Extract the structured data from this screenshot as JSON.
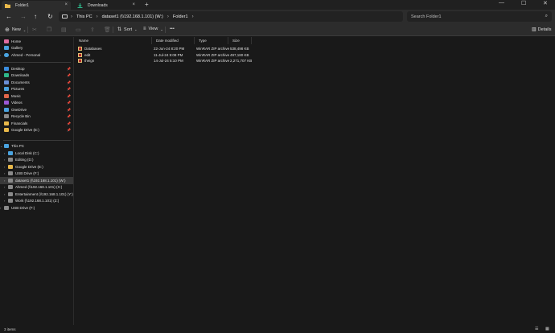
{
  "tabs": [
    {
      "label": "Folder1",
      "active": true
    },
    {
      "label": "Downloads",
      "active": false
    }
  ],
  "window_controls": {
    "minimize": "—",
    "maximize": "☐",
    "close": "✕"
  },
  "address": {
    "crumbs": [
      "This PC",
      "dataset1 (\\\\192.168.1.101) (W:)",
      "Folder1"
    ],
    "separator": "›"
  },
  "search": {
    "placeholder": "Search Folder1"
  },
  "toolbar": {
    "new_label": "New",
    "sort_label": "Sort",
    "view_label": "View",
    "more_label": "•••",
    "details_label": "Details"
  },
  "sidebar": {
    "quick": [
      {
        "label": "Home",
        "icon": "home-icon",
        "color": "#e06c9f"
      },
      {
        "label": "Gallery",
        "icon": "gallery-icon",
        "color": "#4aa3df"
      },
      {
        "label": "Ahmed - Personal",
        "icon": "cloud-icon",
        "color": "#4aa3df"
      }
    ],
    "pinned": [
      {
        "label": "Desktop",
        "icon": "desktop-icon",
        "color": "#3b8ee0"
      },
      {
        "label": "Downloads",
        "icon": "downloads-icon",
        "color": "#2eb88a"
      },
      {
        "label": "Documents",
        "icon": "documents-icon",
        "color": "#6a8fd6"
      },
      {
        "label": "Pictures",
        "icon": "pictures-icon",
        "color": "#4aa3df"
      },
      {
        "label": "Music",
        "icon": "music-icon",
        "color": "#e0664a"
      },
      {
        "label": "Videos",
        "icon": "videos-icon",
        "color": "#9b59d6"
      },
      {
        "label": "OneDrive",
        "icon": "onedrive-icon",
        "color": "#4aa3df"
      },
      {
        "label": "Recycle Bin",
        "icon": "recycle-bin-icon",
        "color": "#8a8a8a"
      },
      {
        "label": "Financials",
        "icon": "folder-icon",
        "color": "#e8b84a"
      },
      {
        "label": "Google Drive (E:)",
        "icon": "drive-icon",
        "color": "#e8b84a"
      }
    ],
    "pc_label": "This PC",
    "drives": [
      {
        "label": "Local Disk (C:)",
        "icon": "disk-icon",
        "color": "#4aa3df",
        "selected": false
      },
      {
        "label": "Editing (D:)",
        "icon": "disk-icon",
        "color": "#8a8a8a",
        "selected": false
      },
      {
        "label": "Google Drive (E:)",
        "icon": "drive-icon",
        "color": "#e8b84a",
        "selected": false
      },
      {
        "label": "USB Drive (F:)",
        "icon": "usb-icon",
        "color": "#8a8a8a",
        "selected": false
      },
      {
        "label": "dataset1 (\\\\192.168.1.101) (W:)",
        "icon": "network-drive-icon",
        "color": "#8a8a8a",
        "selected": true
      },
      {
        "label": "Ahmed (\\\\192.168.1.101) (X:)",
        "icon": "network-drive-icon",
        "color": "#8a8a8a",
        "selected": false
      },
      {
        "label": "Entertainment (\\\\192.168.1.101) (Y:)",
        "icon": "network-drive-icon",
        "color": "#8a8a8a",
        "selected": false
      },
      {
        "label": "Work (\\\\192.168.1.101) (Z:)",
        "icon": "network-drive-icon",
        "color": "#8a8a8a",
        "selected": false
      }
    ],
    "usb_label": "USB Drive (F:)"
  },
  "columns": [
    "Name",
    "Date modified",
    "Type",
    "Size"
  ],
  "files": [
    {
      "name": "Databases",
      "date": "22-Jun-24 8:20 PM",
      "type": "WinRAR ZIP archive",
      "size": "538,498 KB"
    },
    {
      "name": "edit",
      "date": "11-Jul-24 9:08 PM",
      "type": "WinRAR ZIP archive",
      "size": "497,180 KB"
    },
    {
      "name": "theign",
      "date": "14-Jul-24 5:10 PM",
      "type": "WinRAR ZIP archive",
      "size": "2,271,707 KB"
    }
  ],
  "status": {
    "count": "3 items"
  }
}
